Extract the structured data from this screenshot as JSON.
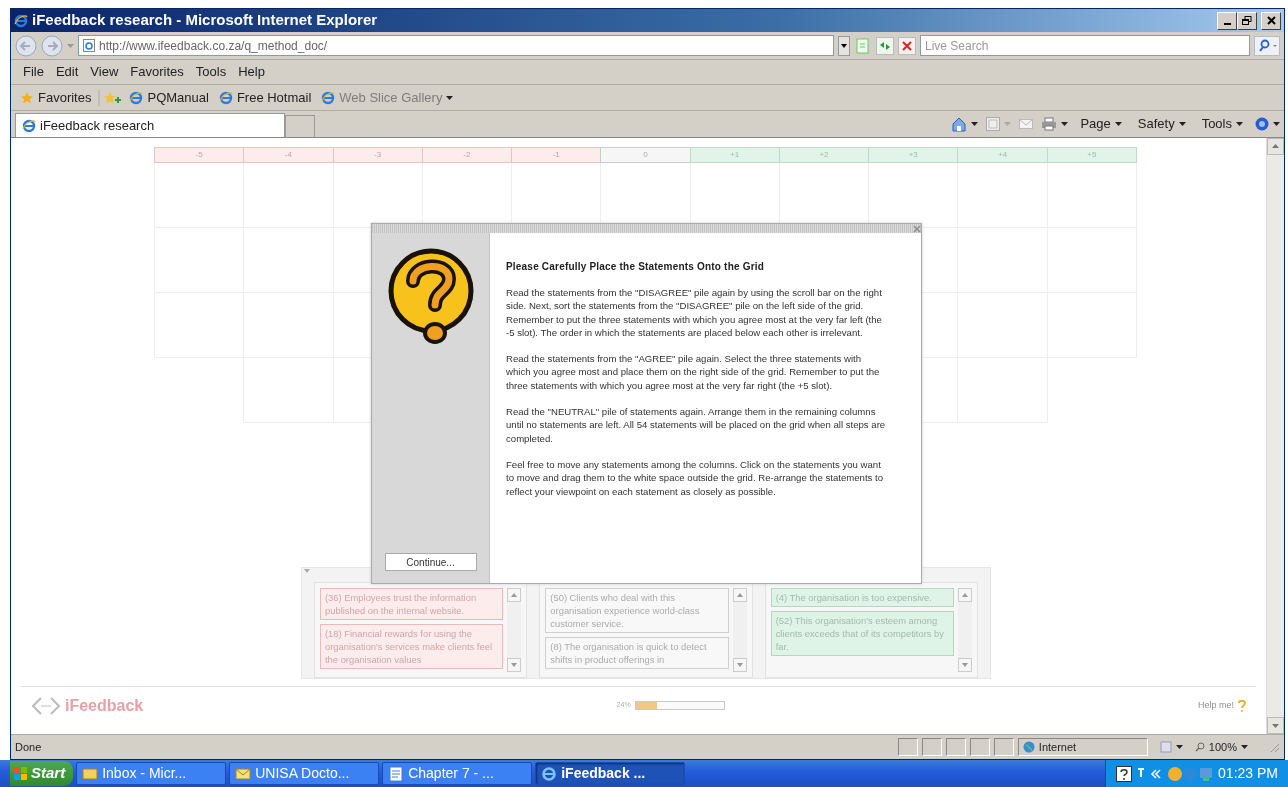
{
  "window": {
    "title": "iFeedback research - Microsoft Internet Explorer"
  },
  "address_bar": {
    "url": "http://www.ifeedback.co.za/q_method_doc/"
  },
  "search": {
    "placeholder": "Live Search"
  },
  "menu": [
    "File",
    "Edit",
    "View",
    "Favorites",
    "Tools",
    "Help"
  ],
  "favorites_bar": {
    "label": "Favorites",
    "links": [
      {
        "label": "PQManual",
        "disabled": false,
        "kind": "link"
      },
      {
        "label": "Free Hotmail",
        "disabled": false,
        "kind": "link"
      },
      {
        "label": "Web Slice Gallery",
        "disabled": true,
        "kind": "menu"
      }
    ]
  },
  "tabs": [
    {
      "label": "iFeedback research",
      "selected": true
    }
  ],
  "command_bar": [
    "Page",
    "Safety",
    "Tools"
  ],
  "grid": {
    "columns": [
      {
        "label": "-5",
        "kind": "disagree"
      },
      {
        "label": "-4",
        "kind": "disagree"
      },
      {
        "label": "-3",
        "kind": "disagree"
      },
      {
        "label": "-2",
        "kind": "disagree"
      },
      {
        "label": "-1",
        "kind": "disagree"
      },
      {
        "label": "0",
        "kind": "neutral"
      },
      {
        "label": "+1",
        "kind": "agree"
      },
      {
        "label": "+2",
        "kind": "agree"
      },
      {
        "label": "+3",
        "kind": "agree"
      },
      {
        "label": "+4",
        "kind": "agree"
      },
      {
        "label": "+5",
        "kind": "agree"
      }
    ]
  },
  "dialog": {
    "heading": "Please Carefully Place the Statements Onto the Grid",
    "paragraphs": [
      "Read the statements from the \"DISAGREE\" pile again by using the scroll bar on the right side. Next, sort the statements from the \"DISAGREE\" pile on the left side of the grid. Remember to put the three statements with which you agree most at the very far left (the -5 slot). The order in which the statements are placed below each other is irrelevant.",
      "Read the statements from the \"AGREE\" pile again. Select the three statements with which you agree most and place them on the right side of the grid. Remember to put the three statements with which you agree most at the very far right (the +5 slot).",
      "Read the \"NEUTRAL\" pile of statements again. Arrange them in the remaining columns until no statements are left. All 54 statements will be placed on the grid when all steps are completed.",
      "Feel free to move any statements among the columns. Click on the statements you want to move and drag them to the white space outside the grid. Re-arrange the statements to reflect your viewpoint on each statement as closely as possible."
    ],
    "button": "Continue..."
  },
  "piles": [
    {
      "kind": "disagree",
      "statements": [
        "(36) Employees trust the information published on the internal website.",
        "(18) Financial rewards for using the organisation's services make clients feel the organisation values"
      ]
    },
    {
      "kind": "neutral",
      "statements": [
        "(50) Clients who deal with this organisation experience world-class customer service.",
        "(8) The organisation is quick to detect shifts in product offerings in"
      ]
    },
    {
      "kind": "agree",
      "statements": [
        "(4) The organisation is too expensive.",
        "(52) This organisation's esteem among clients exceeds that of its competitors by far."
      ]
    }
  ],
  "footer": {
    "logo": "iFeedback",
    "progress": {
      "reading": "24%",
      "level": 0.24
    },
    "help": "Help me!"
  },
  "status_bar": {
    "text": "Done",
    "zone": "Internet",
    "zoom": "100%"
  },
  "taskbar": {
    "start": "Start",
    "items": [
      {
        "label": "Inbox - Micr...",
        "selected": false
      },
      {
        "label": "UNISA Docto...",
        "selected": false
      },
      {
        "label": "Chapter 7 - ...",
        "selected": false
      },
      {
        "label": "iFeedback ...",
        "selected": true
      }
    ],
    "clock": "01:23 PM"
  }
}
